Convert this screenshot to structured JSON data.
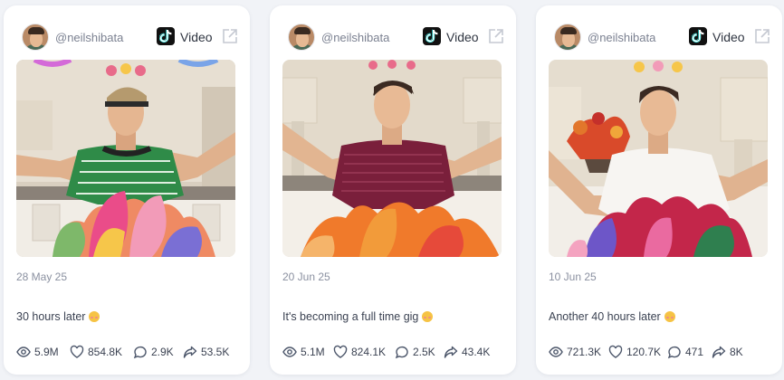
{
  "posts": [
    {
      "handle": "@neilshibata",
      "media_type": "Video",
      "date": "28 May 25",
      "caption": "30 hours later",
      "stats": {
        "views": "5.9M",
        "likes": "854.8K",
        "comments": "2.9K",
        "shares": "53.5K"
      }
    },
    {
      "handle": "@neilshibata",
      "media_type": "Video",
      "date": "20 Jun 25",
      "caption": "It's becoming a full time gig",
      "stats": {
        "views": "5.1M",
        "likes": "824.1K",
        "comments": "2.5K",
        "shares": "43.4K"
      }
    },
    {
      "handle": "@neilshibata",
      "media_type": "Video",
      "date": "10 Jun 25",
      "caption": "Another 40 hours later",
      "stats": {
        "views": "721.3K",
        "likes": "120.7K",
        "comments": "471",
        "shares": "8K"
      }
    }
  ],
  "icons": {
    "platform": "tiktok-icon",
    "external": "external-link-icon",
    "views": "eye-icon",
    "likes": "heart-icon",
    "comments": "comment-icon",
    "shares": "share-icon",
    "caption_emoji": "blushing-face-emoji"
  },
  "colors": {
    "background": "#f1f3f7",
    "card": "#ffffff",
    "muted_text": "#8a90a0",
    "text": "#3b4252"
  }
}
